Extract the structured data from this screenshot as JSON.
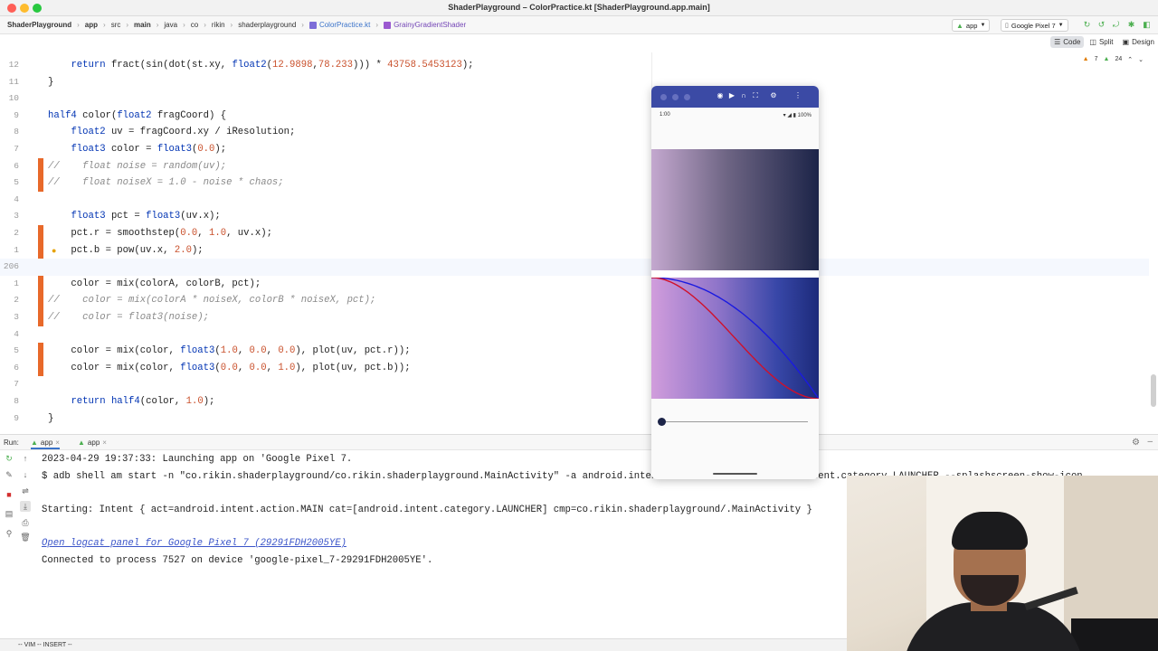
{
  "window": {
    "title": "ShaderPlayground – ColorPractice.kt [ShaderPlayground.app.main]"
  },
  "navbar": {
    "crumbs": [
      "ShaderPlayground",
      "app",
      "src",
      "main",
      "java",
      "co",
      "rikin",
      "shaderplayground",
      "ColorPractice.kt",
      "GrainyGradientShader"
    ],
    "run_config": "app",
    "device": "Google Pixel 7"
  },
  "editor": {
    "view_modes": [
      "Code",
      "Split",
      "Design"
    ],
    "warnings": "7",
    "weak_warnings": "24",
    "lines": [
      {
        "num": "12",
        "code": "    return fract(sin(dot(st.xy, float2(12.9898,78.233))) * 43758.5453123);",
        "comment": false
      },
      {
        "num": "11",
        "code": "}",
        "comment": false
      },
      {
        "num": "10",
        "code": "",
        "comment": false
      },
      {
        "num": "9",
        "code": "half4 color(float2 fragCoord) {",
        "comment": false
      },
      {
        "num": "8",
        "code": "    float2 uv = fragCoord.xy / iResolution;",
        "comment": false
      },
      {
        "num": "7",
        "code": "    float3 color = float3(0.0);",
        "comment": false
      },
      {
        "num": "6",
        "code": "//    float noise = random(uv);",
        "comment": true
      },
      {
        "num": "5",
        "code": "//    float noiseX = 1.0 - noise * chaos;",
        "comment": true
      },
      {
        "num": "4",
        "code": "",
        "comment": false
      },
      {
        "num": "3",
        "code": "    float3 pct = float3(uv.x);",
        "comment": false
      },
      {
        "num": "2",
        "code": "    pct.r = smoothstep(0.0, 1.0, uv.x);",
        "comment": false
      },
      {
        "num": "1",
        "code": "    pct.b = pow(uv.x, 2.0);",
        "comment": false
      },
      {
        "num": "206",
        "code": "",
        "comment": false
      },
      {
        "num": "1",
        "code": "    color = mix(colorA, colorB, pct);",
        "comment": false
      },
      {
        "num": "2",
        "code": "//    color = mix(colorA * noiseX, colorB * noiseX, pct);",
        "comment": true
      },
      {
        "num": "3",
        "code": "//    color = float3(noise);",
        "comment": true
      },
      {
        "num": "4",
        "code": "",
        "comment": false
      },
      {
        "num": "5",
        "code": "    color = mix(color, float3(1.0, 0.0, 0.0), plot(uv, pct.r));",
        "comment": false
      },
      {
        "num": "6",
        "code": "    color = mix(color, float3(0.0, 0.0, 1.0), plot(uv, pct.b));",
        "comment": false
      },
      {
        "num": "7",
        "code": "",
        "comment": false
      },
      {
        "num": "8",
        "code": "    return half4(color, 1.0);",
        "comment": false
      },
      {
        "num": "9",
        "code": "}",
        "comment": false
      }
    ]
  },
  "run": {
    "label": "Run:",
    "tabs": [
      "app",
      "app"
    ],
    "console": [
      "2023-04-29 19:37:33: Launching app on 'Google Pixel 7.",
      "$ adb shell am start -n \"co.rikin.shaderplayground/co.rikin.shaderplayground.MainActivity\" -a android.intent.action.MAIN -c android.intent.category.LAUNCHER --splashscreen-show-icon",
      "",
      "Starting: Intent { act=android.intent.action.MAIN cat=[android.intent.category.LAUNCHER] cmp=co.rikin.shaderplayground/.MainActivity }",
      "",
      "Open logcat panel for Google Pixel 7 (29291FDH2005YE)",
      "Connected to process 7527 on device 'google-pixel_7-29291FDH2005YE'."
    ]
  },
  "status": {
    "mode": "-- VIM -- INSERT --"
  },
  "emulator": {
    "time": "1:00",
    "battery": "100%",
    "slider_value": 0.0,
    "colors": {
      "bar": "#3b4aa5",
      "red_curve": "#d0102a",
      "blue_curve": "#1a1ae0"
    }
  }
}
